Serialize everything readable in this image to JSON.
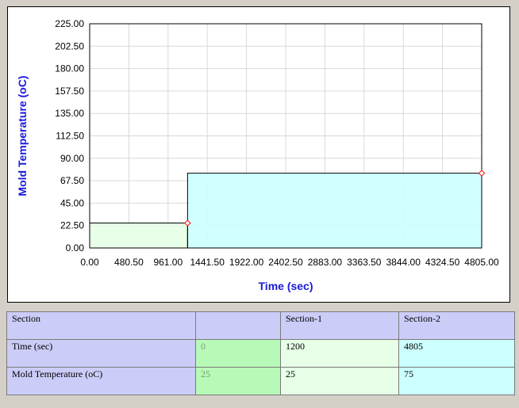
{
  "chart_data": {
    "type": "area",
    "xlabel": "Time (sec)",
    "ylabel": "Mold Temperature (oC)",
    "xlim": [
      0,
      4805
    ],
    "ylim": [
      0,
      225
    ],
    "x_ticks": [
      "0.00",
      "480.50",
      "961.00",
      "1441.50",
      "1922.00",
      "2402.50",
      "2883.00",
      "3363.50",
      "3844.00",
      "4324.50",
      "4805.00"
    ],
    "y_ticks": [
      "0.00",
      "22.50",
      "45.00",
      "67.50",
      "90.00",
      "112.50",
      "135.00",
      "157.50",
      "180.00",
      "202.50",
      "225.00"
    ],
    "grid": true,
    "segments": [
      {
        "x_start": 0,
        "x_end": 1200,
        "y": 25,
        "color": "#e6ffe6"
      },
      {
        "x_start": 1200,
        "x_end": 4805,
        "y": 75,
        "color": "#ccffff"
      }
    ],
    "markers": [
      {
        "x": 1200,
        "y": 25
      },
      {
        "x": 4805,
        "y": 75
      }
    ],
    "colors": {
      "grid": "#d9d9d9",
      "marker": "#ff0000",
      "axis_title": "#1a1adb"
    }
  },
  "table": {
    "header": [
      "Section",
      "",
      "Section-1",
      "Section-2"
    ],
    "rows": [
      {
        "label": "Time (sec)",
        "initial": "0",
        "s1": "1200",
        "s2": "4805"
      },
      {
        "label": "Mold Temperature (oC)",
        "initial": "25",
        "s1": "25",
        "s2": "75"
      }
    ]
  }
}
